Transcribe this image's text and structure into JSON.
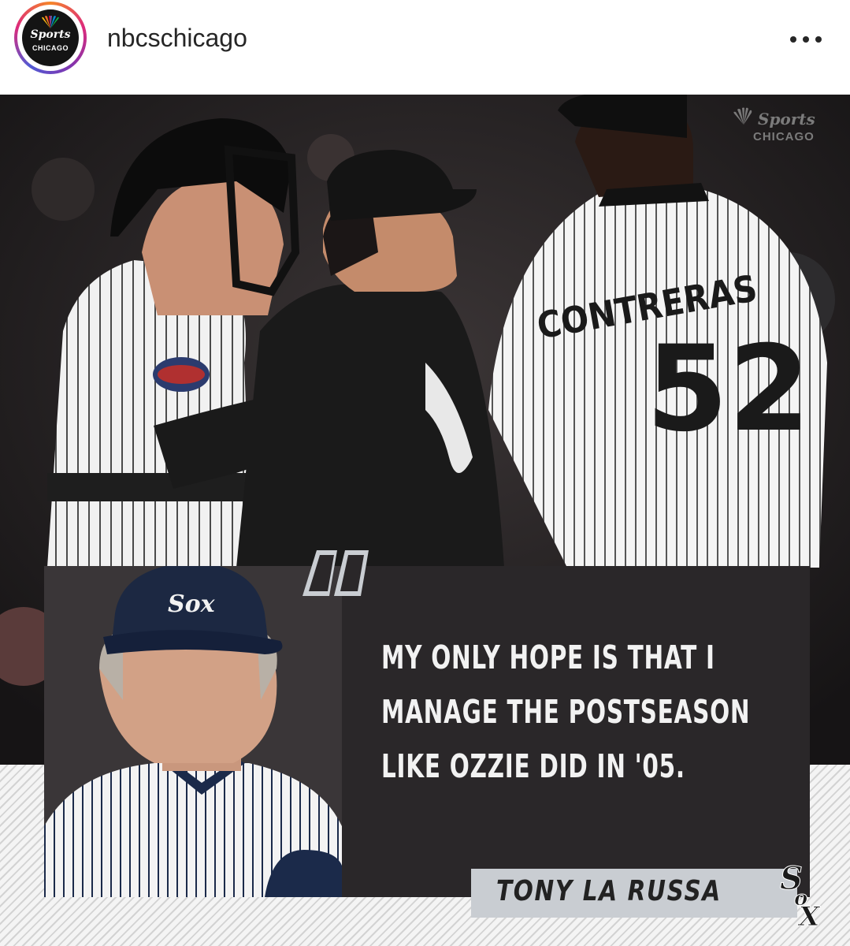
{
  "header": {
    "username": "nbcschicago",
    "avatar": {
      "line1": "Sports",
      "line2": "CHICAGO"
    },
    "more_icon": "more-horizontal-icon"
  },
  "post": {
    "watermark": {
      "line1": "Sports",
      "line2": "CHICAGO"
    },
    "jersey_name": "CONTRERAS",
    "jersey_number": "52",
    "quote_lines": [
      "MY ONLY HOPE IS THAT I",
      "MANAGE THE POSTSEASON",
      "LIKE OZZIE DID IN '05."
    ],
    "attribution": "TONY LA RUSSA",
    "colors": {
      "box": "#2a2729",
      "attribution_bg": "#c9cdd2",
      "text": "#f2f2f2"
    }
  }
}
